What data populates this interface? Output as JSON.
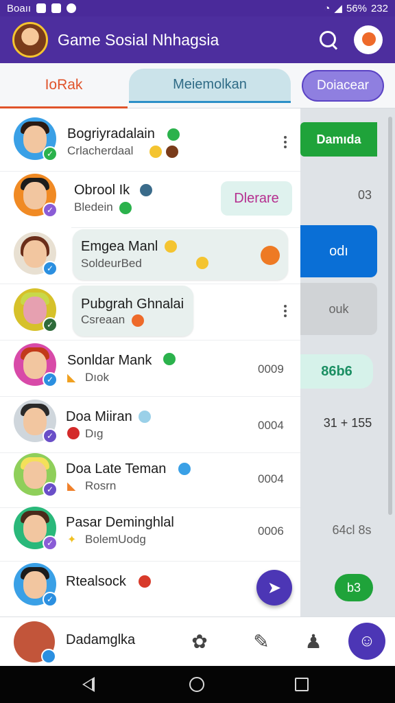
{
  "status_bar": {
    "left_text": "Boaıı",
    "battery": "56%",
    "time": "232",
    "icons": [
      "notification-icon",
      "image-icon",
      "chat-icon",
      "wifi-icon",
      "signal-icon"
    ]
  },
  "app_bar": {
    "title": "Game Sosial Nhhagsia",
    "icons": [
      "search-icon",
      "profile-icon"
    ]
  },
  "tabs": [
    {
      "label": "IoRak"
    },
    {
      "label": "Meiemolkan"
    },
    {
      "label": "Doiacear"
    }
  ],
  "side_panel": [
    {
      "label": "Damıda"
    },
    {
      "label": "03"
    },
    {
      "label": "odı"
    },
    {
      "label": "ouk"
    },
    {
      "label": "86b6"
    },
    {
      "label": "31 + 155"
    },
    {
      "label": "64cl 8s"
    },
    {
      "label": "b3"
    }
  ],
  "chats": [
    {
      "name": "Bogriyradalain",
      "message": "Crlacherdaal",
      "status_color": "#2bb24c",
      "time": ""
    },
    {
      "name": "Obrool Ik",
      "message": "Bledein",
      "status_color": "#8a5cd6",
      "action_label": "Dlerare",
      "time": ""
    },
    {
      "name": "Emgea Manl",
      "message": "SoldeurBed",
      "status_color": "#2b8fe0",
      "time": ""
    },
    {
      "name": "Pubgrah Ghnalai",
      "message": "Csreaan",
      "status_color": "#2e6b3a",
      "time": ""
    },
    {
      "name": "Sonldar Mank",
      "message": "Dıok",
      "status_color": "#2b8fe0",
      "time": "0009"
    },
    {
      "name": "Doa Miiran",
      "message": "Dıg",
      "status_color": "#6a4fc8",
      "time": "0004"
    },
    {
      "name": "Doa Late Teman",
      "message": "Rosrn",
      "status_color": "#6a4fc8",
      "time": "0004"
    },
    {
      "name": "Pasar Deminghlal",
      "message": "BolemUodg",
      "status_color": "#8a5cd6",
      "time": "0006"
    },
    {
      "name": "Rtealsock",
      "message": "",
      "status_color": "#2b8fe0",
      "time": ""
    }
  ],
  "bottom_nav": {
    "user_name": "Dadamglka",
    "icons": [
      "games-icon",
      "tasks-icon",
      "person-icon",
      "group-icon"
    ]
  },
  "colors": {
    "primary": "#4d2e9e",
    "accent_orange": "#e0532a",
    "panel_green": "#1fa33a",
    "panel_blue": "#0a6fd6"
  }
}
